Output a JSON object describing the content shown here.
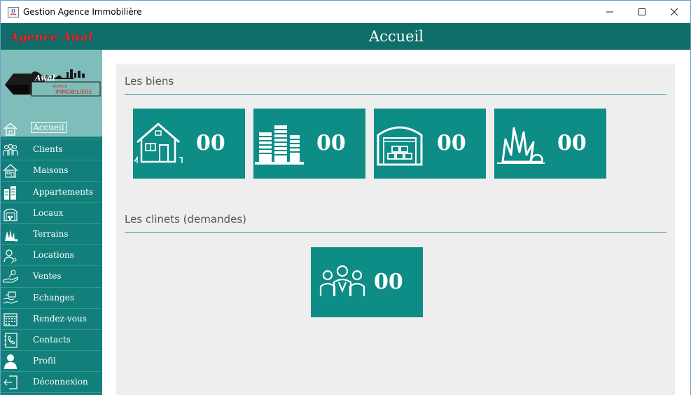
{
  "window": {
    "title": "Gestion Agence Immobilière"
  },
  "sidebar": {
    "brand": "Agence Awal",
    "logo": {
      "top_text": "Awal",
      "sub_text": "AGENCE",
      "main_text": "IMMOBILIÈRE"
    },
    "items": [
      {
        "label": "Accueil",
        "icon": "home-icon",
        "active": true
      },
      {
        "label": "Clients",
        "icon": "people-icon"
      },
      {
        "label": "Maisons",
        "icon": "house-icon"
      },
      {
        "label": "Appartements",
        "icon": "buildings-icon"
      },
      {
        "label": "Locaux",
        "icon": "warehouse-icon"
      },
      {
        "label": "Terrains",
        "icon": "plant-icon"
      },
      {
        "label": "Locations",
        "icon": "renter-icon"
      },
      {
        "label": "Ventes",
        "icon": "sale-icon"
      },
      {
        "label": "Echanges",
        "icon": "exchange-icon"
      },
      {
        "label": "Rendez-vous",
        "icon": "calendar-icon"
      },
      {
        "label": "Contacts",
        "icon": "phonebook-icon"
      },
      {
        "label": "Profil",
        "icon": "user-icon"
      },
      {
        "label": "Déconnexion",
        "icon": "logout-icon"
      }
    ]
  },
  "header": {
    "title": "Accueil"
  },
  "main": {
    "biens_section": {
      "title": "Les biens",
      "cards": [
        {
          "icon": "house-icon",
          "count": "00"
        },
        {
          "icon": "buildings-icon",
          "count": "00"
        },
        {
          "icon": "warehouse-icon",
          "count": "00"
        },
        {
          "icon": "plant-icon",
          "count": "00"
        }
      ]
    },
    "clients_section": {
      "title": "Les clinets (demandes)",
      "cards": [
        {
          "icon": "people-icon",
          "count": "00"
        }
      ]
    }
  },
  "colors": {
    "sidebar": "#127f7b",
    "header": "#0f6e6a",
    "card": "#0e8c86",
    "panel": "#eeeeee",
    "brand_text": "#d42f2f"
  }
}
